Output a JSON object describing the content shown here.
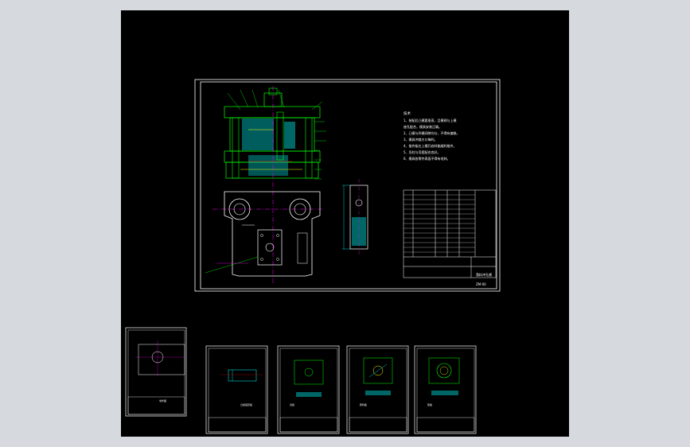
{
  "colors": {
    "background": "#d6d9dd",
    "canvas": "#000000",
    "border": "#ffffff",
    "outline": "#00ff00",
    "center_line": "#ff00ff",
    "hatch": "#00aaaa",
    "leader": "#00ff00",
    "dimension": "#00ffff",
    "text": "#ffffff",
    "text_highlight": "#ffff00"
  },
  "main_drawing": {
    "notes_title": "技术",
    "notes_lines": [
      "1、装配后凸模要垂直，且模柄与上模",
      "座孔配合，模具安装正确。",
      "2、凸模与凹模间隙均匀，不得有偏移。",
      "3、模具冲裁刃口锋利。",
      "4、推件板在上模开启时能顺利推件。",
      "5、导柱与导套配合良好。",
      "6、模具各零件表面不得有毛刺。"
    ],
    "title_block_name": "落料冲孔模",
    "title_block_code": "ZM-00"
  },
  "thumbnails": [
    {
      "name": "sheet-1",
      "title": "零件图",
      "code": "01"
    },
    {
      "name": "sheet-2",
      "title": "凸模固定板",
      "code": "02"
    },
    {
      "name": "sheet-3",
      "title": "凹模",
      "code": "03"
    },
    {
      "name": "sheet-4",
      "title": "卸料板",
      "code": "04"
    },
    {
      "name": "sheet-5",
      "title": "垫板",
      "code": "05"
    }
  ]
}
